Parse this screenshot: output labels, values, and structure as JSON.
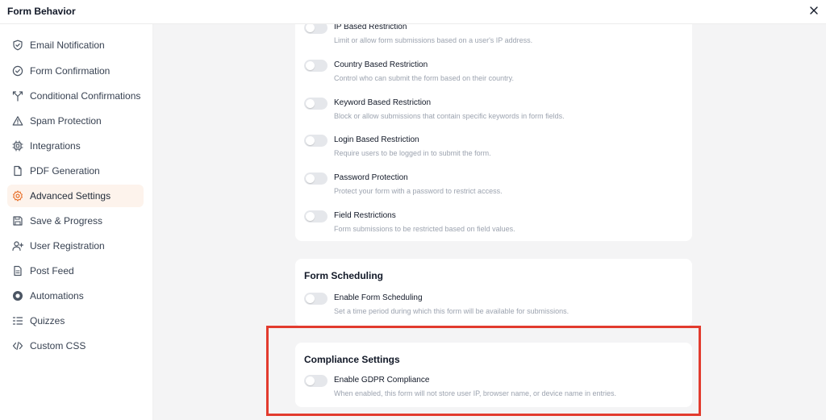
{
  "window": {
    "title": "Form Behavior",
    "close_label": "×"
  },
  "sidebar": {
    "items": [
      {
        "label": "Email Notification",
        "icon": "shield-icon",
        "active": false
      },
      {
        "label": "Form Confirmation",
        "icon": "check-circle-icon",
        "active": false
      },
      {
        "label": "Conditional Confirmations",
        "icon": "split-arrow-icon",
        "active": false
      },
      {
        "label": "Spam Protection",
        "icon": "warning-icon",
        "active": false
      },
      {
        "label": "Integrations",
        "icon": "chip-icon",
        "active": false
      },
      {
        "label": "PDF Generation",
        "icon": "document-icon",
        "active": false
      },
      {
        "label": "Advanced Settings",
        "icon": "gear-icon",
        "active": true
      },
      {
        "label": "Save & Progress",
        "icon": "save-icon",
        "active": false
      },
      {
        "label": "User Registration",
        "icon": "user-plus-icon",
        "active": false
      },
      {
        "label": "Post Feed",
        "icon": "post-icon",
        "active": false
      },
      {
        "label": "Automations",
        "icon": "automation-icon",
        "active": false
      },
      {
        "label": "Quizzes",
        "icon": "list-icon",
        "active": false
      },
      {
        "label": "Custom CSS",
        "icon": "code-icon",
        "active": false
      }
    ]
  },
  "restrictions": {
    "rows": [
      {
        "title": "IP Based Restriction",
        "description": "Limit or allow form submissions based on a user's IP address.",
        "enabled": false
      },
      {
        "title": "Country Based Restriction",
        "description": "Control who can submit the form based on their country.",
        "enabled": false
      },
      {
        "title": "Keyword Based Restriction",
        "description": "Block or allow submissions that contain specific keywords in form fields.",
        "enabled": false
      },
      {
        "title": "Login Based Restriction",
        "description": "Require users to be logged in to submit the form.",
        "enabled": false
      },
      {
        "title": "Password Protection",
        "description": "Protect your form with a password to restrict access.",
        "enabled": false
      },
      {
        "title": "Field Restrictions",
        "description": "Form submissions to be restricted based on field values.",
        "enabled": false
      }
    ]
  },
  "scheduling": {
    "heading": "Form Scheduling",
    "rows": [
      {
        "title": "Enable Form Scheduling",
        "description": "Set a time period during which this form will be available for submissions.",
        "enabled": false
      }
    ]
  },
  "compliance": {
    "heading": "Compliance Settings",
    "rows": [
      {
        "title": "Enable GDPR Compliance",
        "description": "When enabled, this form will not store user IP, browser name, or device name in entries.",
        "enabled": false
      }
    ]
  },
  "colors": {
    "accent": "#e8702a",
    "highlight_border": "#e23b2e",
    "active_bg": "#fdf3ec"
  }
}
